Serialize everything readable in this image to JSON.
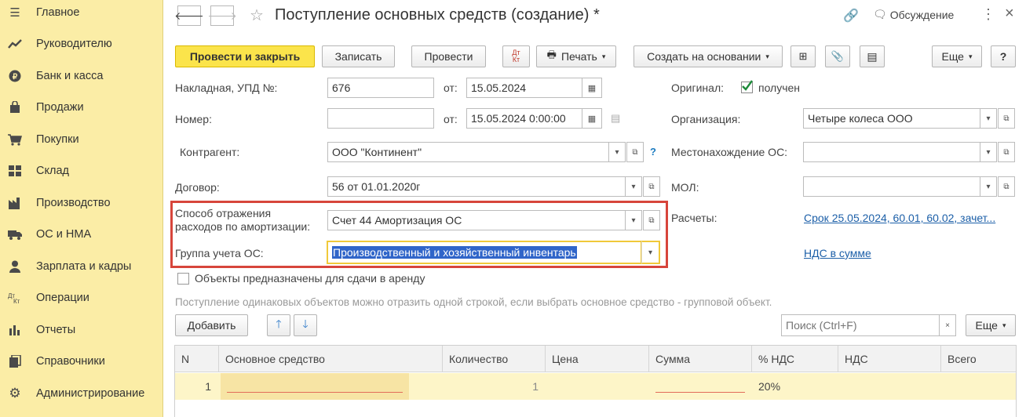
{
  "sidebar": {
    "items": [
      {
        "label": "Главное",
        "icon": "menu-icon"
      },
      {
        "label": "Руководителю",
        "icon": "trend-icon"
      },
      {
        "label": "Банк и касса",
        "icon": "coin-icon"
      },
      {
        "label": "Продажи",
        "icon": "bag-icon"
      },
      {
        "label": "Покупки",
        "icon": "cart-icon"
      },
      {
        "label": "Склад",
        "icon": "warehouse-icon"
      },
      {
        "label": "Производство",
        "icon": "factory-icon"
      },
      {
        "label": "ОС и НМА",
        "icon": "truck-icon"
      },
      {
        "label": "Зарплата и кадры",
        "icon": "person-icon"
      },
      {
        "label": "Операции",
        "icon": "dt-kt-icon"
      },
      {
        "label": "Отчеты",
        "icon": "bar-chart-icon"
      },
      {
        "label": "Справочники",
        "icon": "books-icon"
      },
      {
        "label": "Администрирование",
        "icon": "gear-icon"
      }
    ]
  },
  "header": {
    "title": "Поступление основных средств (создание) *",
    "discussion": "Обсуждение"
  },
  "toolbar": {
    "post_close": "Провести и закрыть",
    "save": "Записать",
    "post": "Провести",
    "dtkt": "Дт Кт",
    "print": "Печать",
    "create_based": "Создать на основании",
    "more": "Еще",
    "help": "?"
  },
  "form": {
    "invoice_label": "Накладная, УПД №:",
    "invoice_value": "676",
    "from_label": "от:",
    "invoice_date": "15.05.2024",
    "number_label": "Номер:",
    "number_value": "",
    "number_date": "15.05.2024  0:00:00",
    "original_label": "Оригинал:",
    "original_value": "получен",
    "org_label": "Организация:",
    "org_value": "Четыре колеса ООО",
    "contractor_label": "Контрагент:",
    "contractor_value": "ООО \"Континент\"",
    "help_mark": "?",
    "location_label": "Местонахождение ОС:",
    "location_value": "",
    "contract_label": "Договор:",
    "contract_value": "56 от 01.01.2020г",
    "mol_label": "МОЛ:",
    "mol_value": "",
    "depr_label_1": "Способ отражения",
    "depr_label_2": "расходов по амортизации:",
    "depr_value": "Счет 44 Амортизация ОС",
    "settlements_label": "Расчеты:",
    "settlements_value": "Срок 25.05.2024, 60.01, 60.02, зачет...",
    "group_label": "Группа учета ОС:",
    "group_value": "Производственный и хозяйственный инвентарь",
    "vat_link": "НДС в сумме",
    "rent_label": "Объекты предназначены для сдачи в аренду",
    "hint": "Поступление одинаковых объектов можно отразить одной строкой, если выбрать основное средство - групповой объект."
  },
  "table_toolbar": {
    "add": "Добавить",
    "search_placeholder": "Поиск (Ctrl+F)",
    "clear": "×",
    "more": "Еще"
  },
  "table": {
    "columns": [
      "N",
      "Основное средство",
      "Количество",
      "Цена",
      "Сумма",
      "% НДС",
      "НДС",
      "Всего"
    ],
    "rows": [
      {
        "n": "1",
        "asset": "",
        "qty": "1",
        "price": "",
        "sum": "",
        "vat_rate": "20%",
        "vat": "",
        "total": ""
      }
    ]
  }
}
